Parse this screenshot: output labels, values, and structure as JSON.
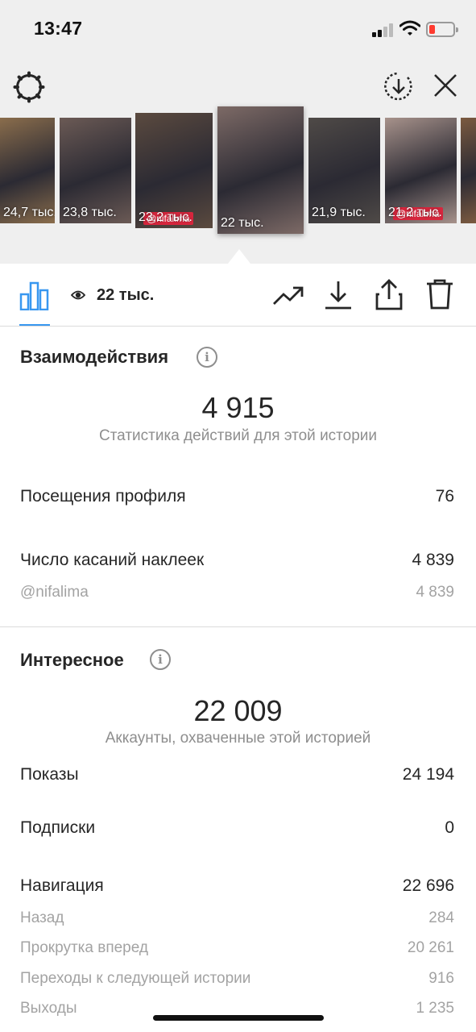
{
  "status_bar": {
    "time": "13:47"
  },
  "stories": [
    {
      "views": "24,7 тыс.",
      "color": "#8a6d4c"
    },
    {
      "views": "23,8 тыс.",
      "color": "#6b5a55"
    },
    {
      "views": "23,2 тыс.",
      "color": "#5b4a3f",
      "label": "@nifalima"
    },
    {
      "views": "22 тыс.",
      "color": "#7d6a66",
      "selected": true
    },
    {
      "views": "21,9 тыс.",
      "color": "#4f4a47"
    },
    {
      "views": "21,2 тыс.",
      "color": "#a7928b",
      "label": "@nifalima"
    },
    {
      "views": "",
      "color": "#7b5a40"
    }
  ],
  "toolbar": {
    "views": "22 тыс."
  },
  "interactions": {
    "title": "Взаимодействия",
    "total": "4 915",
    "subtitle": "Статистика действий для этой истории",
    "rows": [
      {
        "label": "Посещения профиля",
        "value": "76"
      },
      {
        "label": "Число касаний наклеек",
        "value": "4 839"
      }
    ],
    "sub_rows": [
      {
        "label": "@nifalima",
        "value": "4 839"
      }
    ]
  },
  "discovery": {
    "title": "Интересное",
    "total": "22 009",
    "subtitle": "Аккаунты, охваченные этой историей",
    "rows": [
      {
        "label": "Показы",
        "value": "24 194"
      },
      {
        "label": "Подписки",
        "value": "0"
      },
      {
        "label": "Навигация",
        "value": "22 696"
      }
    ],
    "nav_rows": [
      {
        "label": "Назад",
        "value": "284"
      },
      {
        "label": "Прокрутка вперед",
        "value": "20 261"
      },
      {
        "label": "Переходы к следующей истории",
        "value": "916"
      },
      {
        "label": "Выходы",
        "value": "1 235"
      }
    ]
  },
  "icons": [
    "gear-icon",
    "download-circle-icon",
    "close-icon",
    "bar-chart-icon",
    "eye-icon",
    "trending-icon",
    "download-icon",
    "share-icon",
    "trash-icon",
    "info-icon"
  ],
  "colors": {
    "accent": "#3897f0",
    "text": "#262626",
    "secondary": "#8e8e8e",
    "battery_low": "#ff3b30"
  }
}
